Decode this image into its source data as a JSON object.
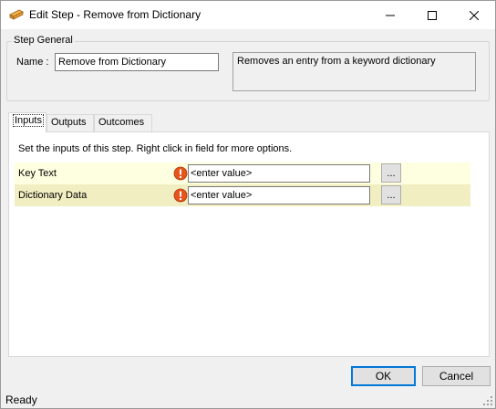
{
  "window": {
    "title": "Edit Step - Remove from Dictionary",
    "app_icon": "step-icon",
    "controls": [
      "minimize-icon",
      "maximize-icon",
      "close-icon"
    ]
  },
  "step_general": {
    "group_title": "Step General",
    "name_label": "Name :",
    "name_value": "Remove from Dictionary",
    "description": "Removes an entry from a keyword dictionary"
  },
  "tabs": [
    {
      "label": "Inputs",
      "active": true
    },
    {
      "label": "Outputs",
      "active": false
    },
    {
      "label": "Outcomes",
      "active": false
    }
  ],
  "inputs_panel": {
    "hint": "Set the inputs of this step.  Right click in field for more options.",
    "rows": [
      {
        "label": "Key Text",
        "value": "<enter value>",
        "icon": "warning-icon",
        "button": "..."
      },
      {
        "label": "Dictionary Data",
        "value": "<enter value>",
        "icon": "warning-icon",
        "button": "..."
      }
    ]
  },
  "buttons": {
    "ok": "OK",
    "cancel": "Cancel"
  },
  "status": {
    "text": "Ready"
  },
  "colors": {
    "row_odd": "#fefee0",
    "row_even": "#f1eec1",
    "warning": "#e8541b",
    "focus_border": "#0078d7"
  }
}
